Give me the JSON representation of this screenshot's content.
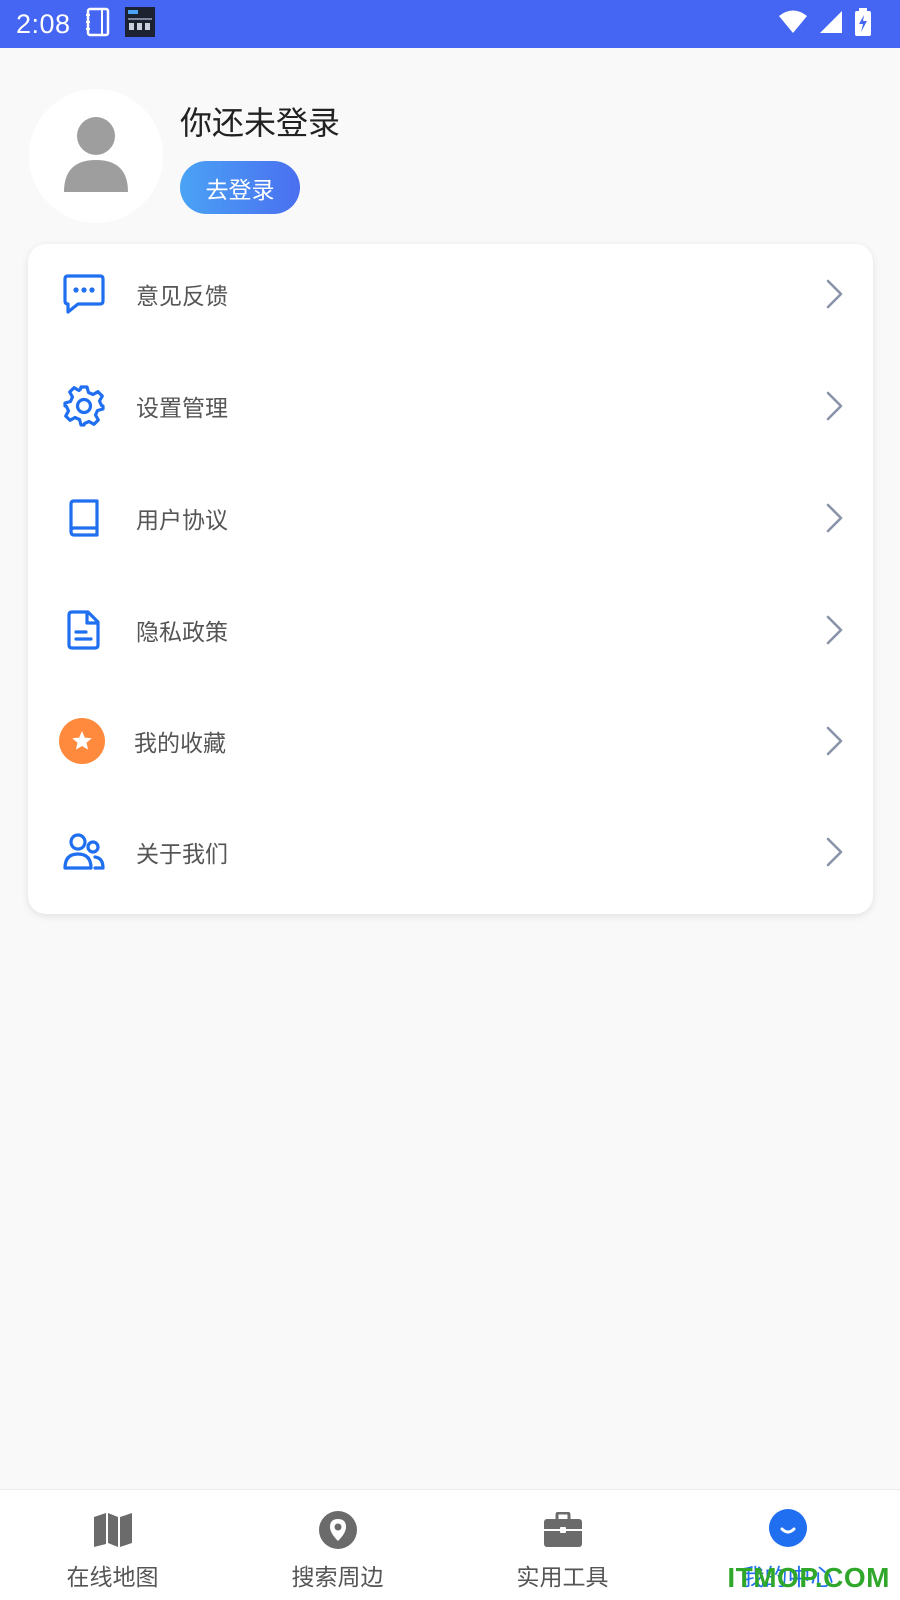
{
  "status_bar": {
    "time": "2:08",
    "bg_color": "#4566f2",
    "icons": [
      "notebook-icon",
      "clock-widget-icon",
      "wifi-icon",
      "cell-signal-icon",
      "battery-charging-icon"
    ]
  },
  "profile": {
    "name": "你还未登录",
    "login_button": "去登录",
    "avatar_icon": "person-placeholder-icon"
  },
  "menu": {
    "items": [
      {
        "label": "意见反馈",
        "icon": "chat-dots-icon"
      },
      {
        "label": "设置管理",
        "icon": "gear-icon"
      },
      {
        "label": "用户协议",
        "icon": "book-icon"
      },
      {
        "label": "隐私政策",
        "icon": "document-icon"
      },
      {
        "label": "我的收藏",
        "icon": "star-circle-icon"
      },
      {
        "label": "关于我们",
        "icon": "users-icon"
      }
    ]
  },
  "bottom_nav": {
    "items": [
      {
        "label": "在线地图",
        "icon": "map-icon",
        "active": false
      },
      {
        "label": "搜索周边",
        "icon": "location-pin-icon",
        "active": false
      },
      {
        "label": "实用工具",
        "icon": "briefcase-icon",
        "active": false
      },
      {
        "label": "我的中心",
        "icon": "smile-circle-icon",
        "active": true
      }
    ]
  },
  "watermark": "ITMOP.COM",
  "colors": {
    "accent": "#1f6ff0",
    "star": "#ff8a3d",
    "chevron": "#8a94a8"
  }
}
